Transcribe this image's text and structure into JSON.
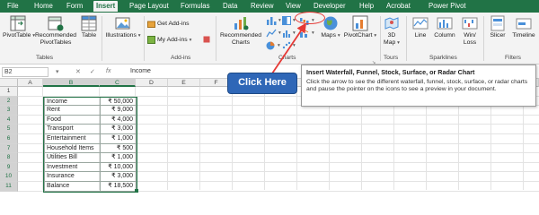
{
  "tabs": [
    "File",
    "Home",
    "Form",
    "Insert",
    "Page Layout",
    "Formulas",
    "Data",
    "Review",
    "View",
    "Developer",
    "Help",
    "Acrobat",
    "Power Pivot"
  ],
  "ribbon": {
    "tables": {
      "pivottable": "PivotTable",
      "recommended": "Recommended PivotTables",
      "table": "Table",
      "group": "Tables"
    },
    "illustrations": {
      "label": "Illustrations"
    },
    "addins": {
      "get": "Get Add-ins",
      "my": "My Add-ins",
      "group": "Add-ins"
    },
    "charts": {
      "recommended": "Recommended Charts",
      "group": "Charts",
      "maps": "Maps",
      "pivotchart": "PivotChart"
    },
    "tours": {
      "map3d": "3D Map",
      "group": "Tours"
    },
    "sparklines": {
      "line": "Line",
      "column": "Column",
      "winloss": "Win/ Loss",
      "group": "Sparklines"
    },
    "filters": {
      "slicer": "Slicer",
      "timeline": "Timeline",
      "group": "Filters"
    }
  },
  "formula_bar": {
    "name_box": "B2",
    "fx": "fx",
    "value": "Income"
  },
  "columns": [
    "A",
    "B",
    "C",
    "D",
    "E",
    "F",
    "G",
    "H",
    "I",
    "J",
    "K",
    "L",
    "M",
    "N",
    "O",
    "P",
    "Q",
    "R"
  ],
  "rows": [
    "1",
    "2",
    "3",
    "4",
    "5",
    "6",
    "7",
    "8",
    "9",
    "10",
    "11"
  ],
  "table_rows": [
    {
      "label": "Income",
      "value": "₹ 50,000"
    },
    {
      "label": "Rent",
      "value": "₹ 9,000"
    },
    {
      "label": "Food",
      "value": "₹ 4,000"
    },
    {
      "label": "Transport",
      "value": "₹ 3,000"
    },
    {
      "label": "Entertainment",
      "value": "₹ 1,000"
    },
    {
      "label": "Household Items",
      "value": "₹ 500"
    },
    {
      "label": "Utilities Bill",
      "value": "₹ 1,000"
    },
    {
      "label": "Investment",
      "value": "₹ 10,000"
    },
    {
      "label": "Insurance",
      "value": "₹ 3,000"
    },
    {
      "label": "Balance",
      "value": "₹ 18,500"
    }
  ],
  "tooltip": {
    "title": "Insert Waterfall, Funnel, Stock, Surface, or Radar Chart",
    "body": "Click the arrow to see the different waterfall, funnel, stock, surface, or radar charts and pause the pointer on the icons to see a preview in your document."
  },
  "callout": "Click Here",
  "colors": {
    "excel_green": "#217346",
    "callout_blue": "#2f67b7",
    "highlight_red": "#e53935"
  }
}
